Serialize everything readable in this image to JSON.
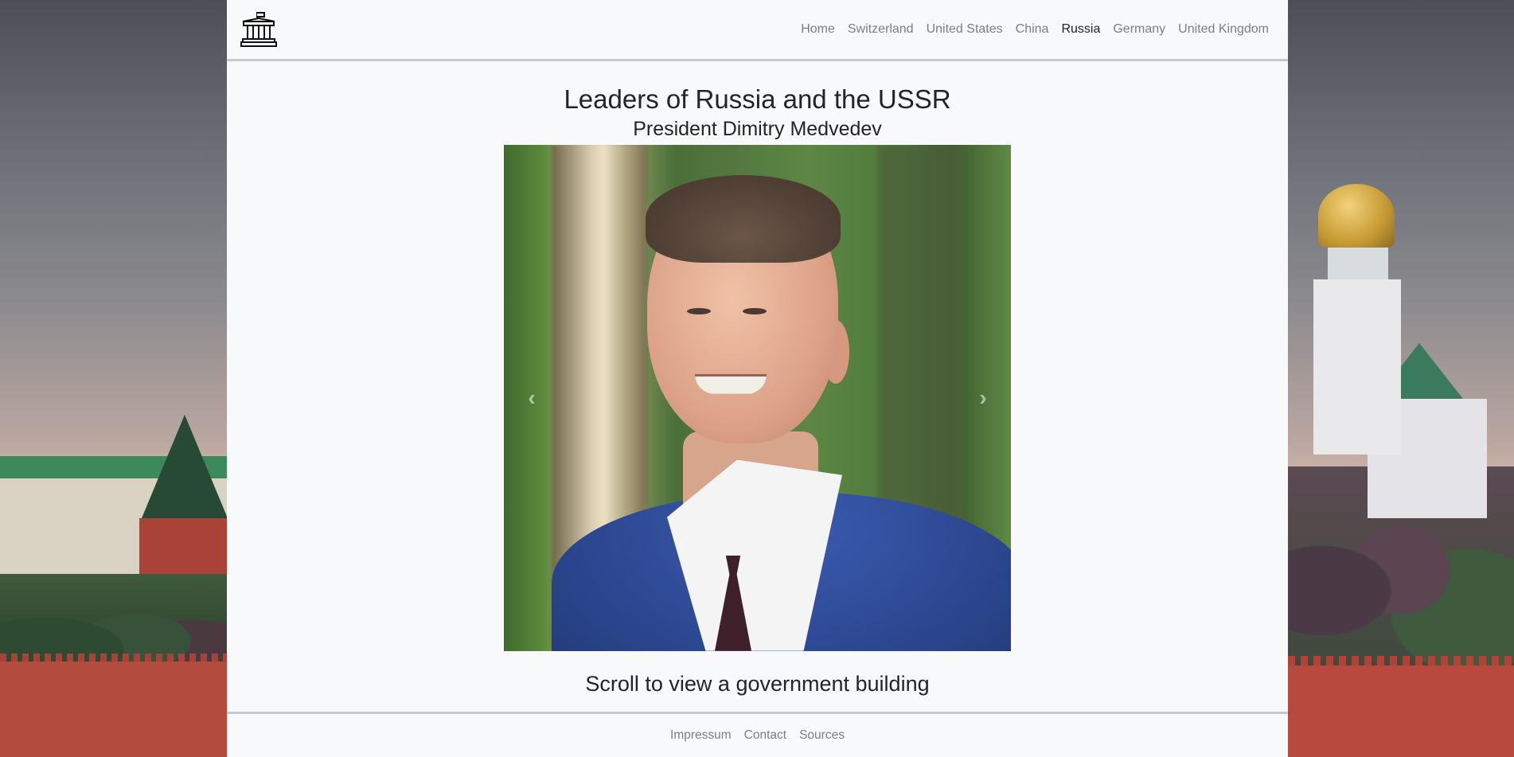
{
  "nav": {
    "logo_icon": "government-building-icon",
    "items": [
      {
        "label": "Home",
        "active": false
      },
      {
        "label": "Switzerland",
        "active": false
      },
      {
        "label": "United States",
        "active": false
      },
      {
        "label": "China",
        "active": false
      },
      {
        "label": "Russia",
        "active": true
      },
      {
        "label": "Germany",
        "active": false
      },
      {
        "label": "United Kingdom",
        "active": false
      }
    ]
  },
  "main": {
    "title": "Leaders of Russia and the USSR",
    "subtitle": "President Dimitry Medvedev",
    "carousel": {
      "prev_icon": "chevron-left-icon",
      "next_icon": "chevron-right-icon"
    },
    "scroll_hint": "Scroll to view a government building"
  },
  "footer": {
    "links": [
      "Impressum",
      "Contact",
      "Sources"
    ]
  },
  "colors": {
    "page_bg": "#f8f9fa",
    "nav_text": "#7a7f85",
    "nav_active": "#212529",
    "divider": "#c8c9cc"
  }
}
